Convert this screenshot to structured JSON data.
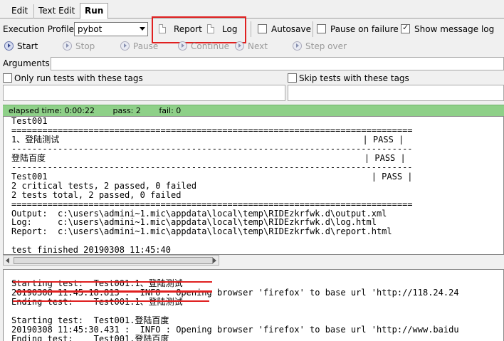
{
  "tabs": [
    {
      "label": "Edit",
      "active": false
    },
    {
      "label": "Text Edit",
      "active": false
    },
    {
      "label": "Run",
      "active": true
    }
  ],
  "execution": {
    "profile_label": "Execution Profile:",
    "profile_value": "pybot",
    "report_label": "Report",
    "log_label": "Log",
    "autosave_label": "Autosave",
    "autosave_checked": false,
    "pause_label": "Pause on failure",
    "pause_checked": false,
    "show_message_label": "Show message log",
    "show_message_checked": true
  },
  "toolbar": {
    "start": "Start",
    "stop": "Stop",
    "pause": "Pause",
    "continue": "Continue",
    "next": "Next",
    "step_over": "Step over"
  },
  "arguments": {
    "label": "Arguments:",
    "value": ""
  },
  "tags": {
    "include_label": "Only run tests with these tags",
    "include_checked": false,
    "exclude_label": "Skip tests with these tags",
    "exclude_checked": false
  },
  "status": {
    "elapsed": "elapsed time: 0:00:22",
    "pass": "pass: 2",
    "fail": "fail: 0"
  },
  "output_text": "Test001\n==============================================================================\n1、登陆测试                                                           | PASS |\n------------------------------------------------------------------------------\n登陆百度                                                              | PASS |\n------------------------------------------------------------------------------\nTest001                                                               | PASS |\n2 critical tests, 2 passed, 0 failed\n2 tests total, 2 passed, 0 failed\n==============================================================================\nOutput:  c:\\users\\admini~1.mic\\appdata\\local\\temp\\RIDEzkrfwk.d\\output.xml\nLog:     c:\\users\\admini~1.mic\\appdata\\local\\temp\\RIDEzkrfwk.d\\log.html\nReport:  c:\\users\\admini~1.mic\\appdata\\local\\temp\\RIDEzkrfwk.d\\report.html\n\ntest finished 20190308 11:45:40",
  "message_text": "Starting test:  Test001.1、登陆测试\n20190308 11:45:18.813 :  INFO : Opening browser 'firefox' to base url 'http://118.24.24\nEnding test:    Test001.1、登陆测试\n\nStarting test:  Test001.登陆百度\n20190308 11:45:30.431 :  INFO : Opening browser 'firefox' to base url 'http://www.baidu\nEnding test:    Test001.登陆百度",
  "colors": {
    "status_bar": "#8ed088",
    "highlight_box": "#e02020"
  }
}
